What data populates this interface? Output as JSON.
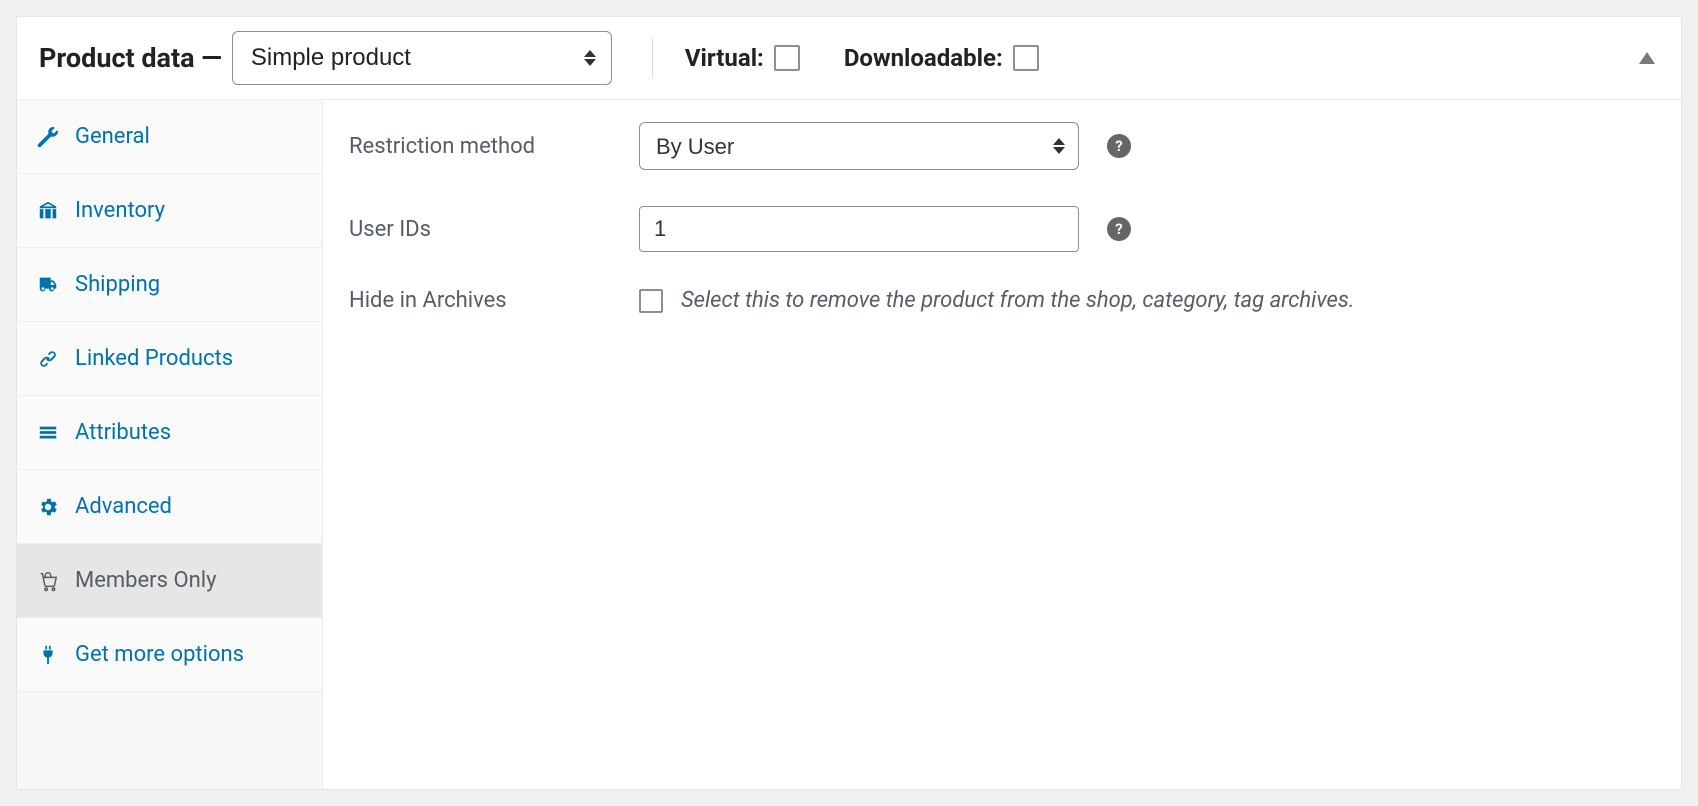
{
  "header": {
    "title": "Product data —",
    "product_type_selected": "Simple product",
    "virtual_label": "Virtual:",
    "downloadable_label": "Downloadable:"
  },
  "tabs": {
    "general": "General",
    "inventory": "Inventory",
    "shipping": "Shipping",
    "linked_products": "Linked Products",
    "attributes": "Attributes",
    "advanced": "Advanced",
    "members_only": "Members Only",
    "get_more_options": "Get more options"
  },
  "content": {
    "restriction_method_label": "Restriction method",
    "restriction_method_value": "By User",
    "user_ids_label": "User IDs",
    "user_ids_value": "1",
    "hide_in_archives_label": "Hide in Archives",
    "hide_in_archives_hint": "Select this to remove the product from the shop, category, tag archives."
  },
  "colors": {
    "accent": "#0073aa",
    "text_muted": "#555d66",
    "border": "#8c8f94",
    "panel_bg": "#ffffff",
    "page_bg": "#f1f1f1",
    "tab_active_bg": "#e6e6e6"
  }
}
